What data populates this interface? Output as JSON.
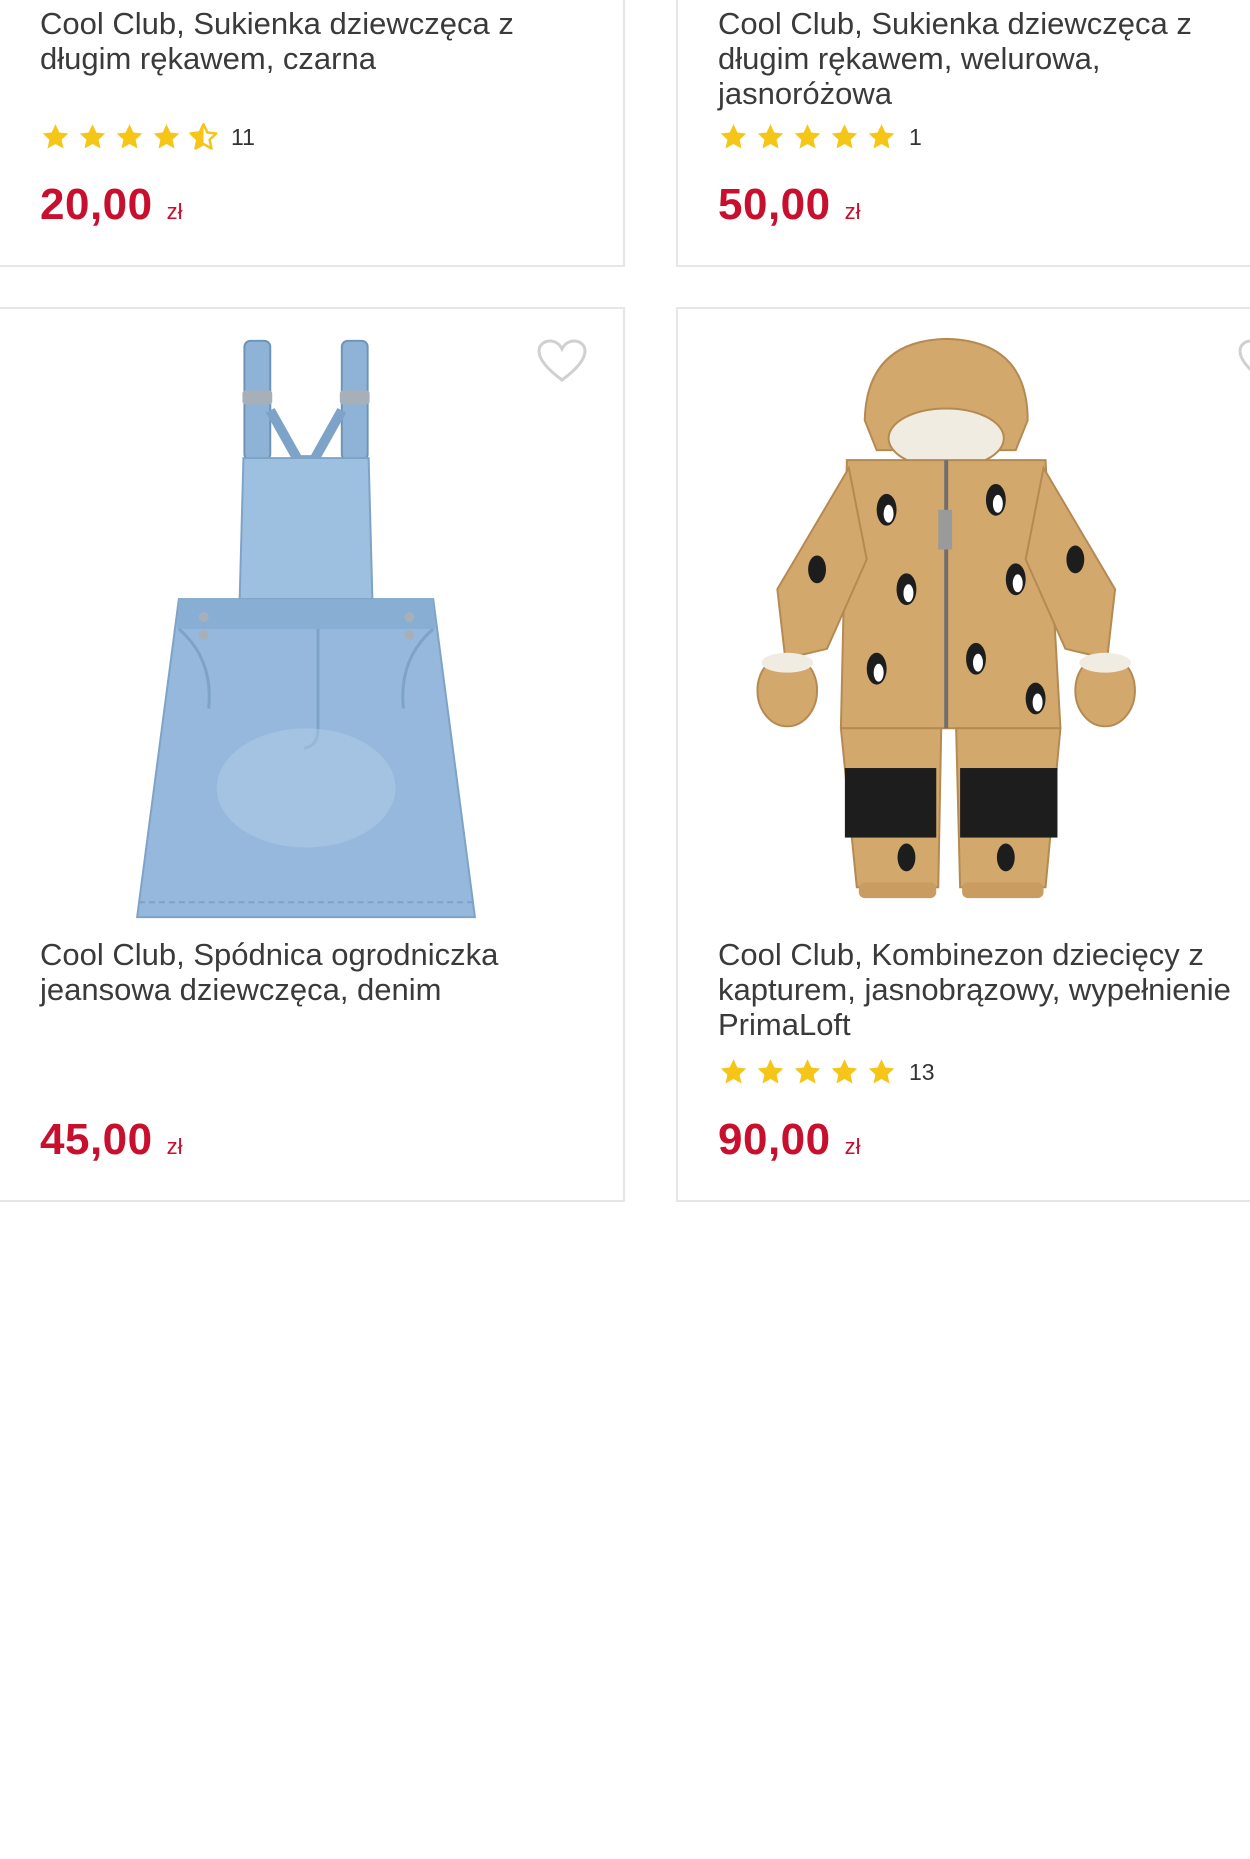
{
  "products": [
    {
      "title": "Cool Club, Sukienka dziewczęca z długim rękawem, czarna",
      "rating": 4.5,
      "rating_count": "11",
      "price": "20,00",
      "currency": "zł"
    },
    {
      "title": "Cool Club, Sukienka dziewczęca z długim rękawem, welurowa, jasnoróżowa",
      "rating": 5,
      "rating_count": "1",
      "price": "50,00",
      "currency": "zł"
    },
    {
      "title": "Cool Club, Spódnica ogrodniczka jeansowa dziewczęca, denim",
      "price": "45,00",
      "currency": "zł",
      "image": "denim-overall-skirt"
    },
    {
      "title": "Cool Club, Kombinezon dziecięcy z kapturem, jasnobrązowy, wypełnienie PrimaLoft",
      "rating": 5,
      "rating_count": "13",
      "price": "90,00",
      "currency": "zł",
      "image": "penguin-print-snowsuit"
    }
  ],
  "colors": {
    "price": "#c8102e",
    "star": "#f5c518",
    "border": "#e6e6e6",
    "heart": "#d0d0d0"
  },
  "icons": {
    "favorite": "heart-outline-icon",
    "star": "star-icon"
  }
}
